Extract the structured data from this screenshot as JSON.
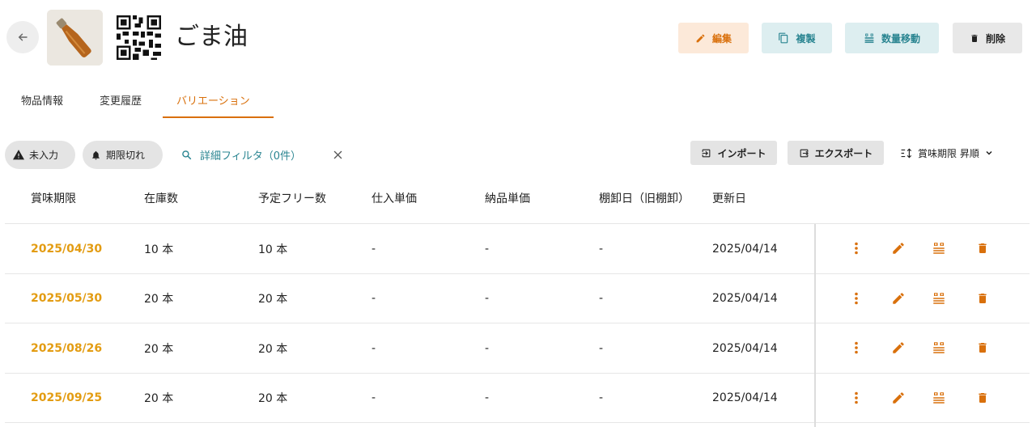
{
  "header": {
    "title": "ごま油",
    "back_icon": "arrow-left-icon",
    "buttons": {
      "edit": "編集",
      "copy": "複製",
      "move": "数量移動",
      "delete": "削除"
    }
  },
  "tabs": [
    {
      "label": "物品情報",
      "active": false
    },
    {
      "label": "変更履歴",
      "active": false
    },
    {
      "label": "バリエーション",
      "active": true
    }
  ],
  "filters": {
    "chip_missing": "未入力",
    "chip_expired": "期限切れ",
    "detail_filter": "詳細フィルタ（0件）"
  },
  "toolbar": {
    "import": "インポート",
    "export": "エクスポート",
    "sort_label": "賞味期限 昇順"
  },
  "table": {
    "headers": [
      "賞味期限",
      "在庫数",
      "予定フリー数",
      "仕入単価",
      "納品単価",
      "棚卸日（旧棚卸）",
      "更新日"
    ],
    "rows": [
      [
        "2025/04/30",
        "10 本",
        "10 本",
        "-",
        "-",
        "-",
        "2025/04/14"
      ],
      [
        "2025/05/30",
        "20 本",
        "20 本",
        "-",
        "-",
        "-",
        "2025/04/14"
      ],
      [
        "2025/08/26",
        "20 本",
        "20 本",
        "-",
        "-",
        "-",
        "2025/04/14"
      ],
      [
        "2025/09/25",
        "20 本",
        "20 本",
        "-",
        "-",
        "-",
        "2025/04/14"
      ]
    ]
  },
  "colors": {
    "accent_orange": "#d9700c",
    "date_orange": "#e39c12",
    "teal": "#2a8591"
  }
}
